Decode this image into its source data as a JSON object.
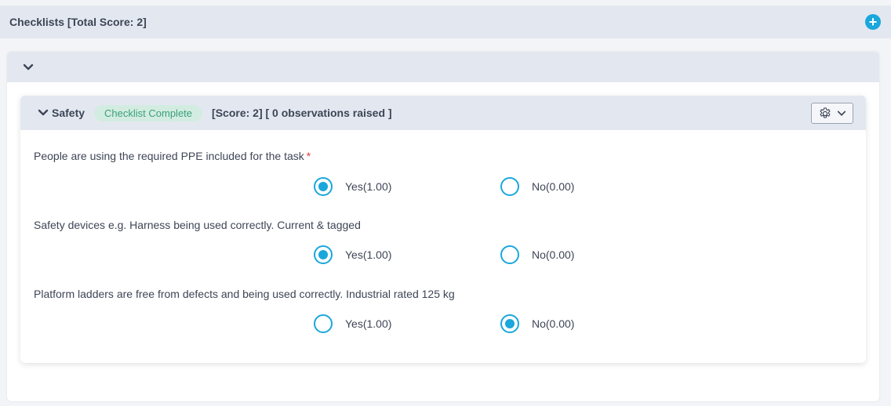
{
  "header": {
    "title": "Checklists [Total Score: 2]",
    "add_icon": "plus-circle-icon"
  },
  "section": {
    "name": "Safety",
    "status_badge": "Checklist Complete",
    "score_text": "[Score: 2] [ 0 observations raised ]",
    "settings_icon": "gear-icon"
  },
  "questions": [
    {
      "text": "People are using the required PPE included for the task",
      "required": "*",
      "options": [
        {
          "label": "Yes(1.00)",
          "selected": true
        },
        {
          "label": "No(0.00)",
          "selected": false
        }
      ]
    },
    {
      "text": "Safety devices e.g. Harness being used correctly. Current & tagged",
      "required": "",
      "options": [
        {
          "label": "Yes(1.00)",
          "selected": true
        },
        {
          "label": "No(0.00)",
          "selected": false
        }
      ]
    },
    {
      "text": "Platform ladders are free from defects and being used correctly. Industrial rated 125 kg",
      "required": "",
      "options": [
        {
          "label": "Yes(1.00)",
          "selected": false
        },
        {
          "label": "No(0.00)",
          "selected": true
        }
      ]
    }
  ],
  "colors": {
    "accent": "#1aa7dc",
    "badge_bg": "#d3ece1",
    "badge_text": "#3aa17a",
    "header_bg": "#e3e8f0"
  }
}
